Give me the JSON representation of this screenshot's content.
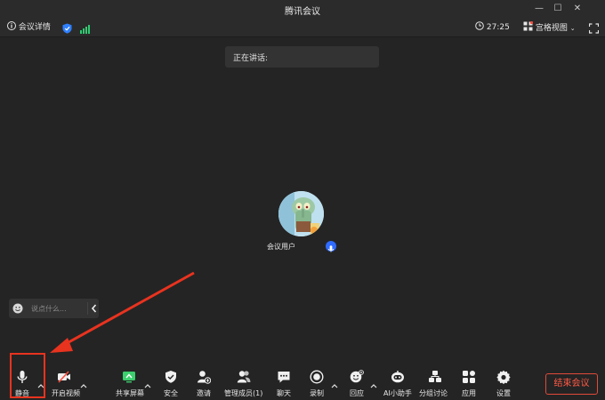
{
  "window": {
    "title": "腾讯会议",
    "controls": [
      "minimize-icon",
      "maximize-icon",
      "close-icon"
    ]
  },
  "infobar": {
    "meeting_details": "会议详情",
    "timer": "27:25",
    "view_mode": "宫格视图",
    "signal_color": "#2ecc71",
    "shield_color": "#2f80ff"
  },
  "speaking": {
    "label": "正在讲话:"
  },
  "participant": {
    "name": "会议用户",
    "mic_color": "#2f6bff"
  },
  "chat": {
    "placeholder": "说点什么..."
  },
  "toolbar": {
    "mute": "静音",
    "start_video": "开启视频",
    "share_screen": "共享屏幕",
    "security": "安全",
    "invite": "邀请",
    "manage_members": "管理成员(1)",
    "chat": "聊天",
    "record": "录制",
    "react": "回应",
    "ai_assistant": "AI小助手",
    "breakout": "分组讨论",
    "apps": "应用",
    "settings": "设置",
    "end_meeting": "结束会议"
  },
  "annotation": {
    "color": "#e8331f"
  }
}
